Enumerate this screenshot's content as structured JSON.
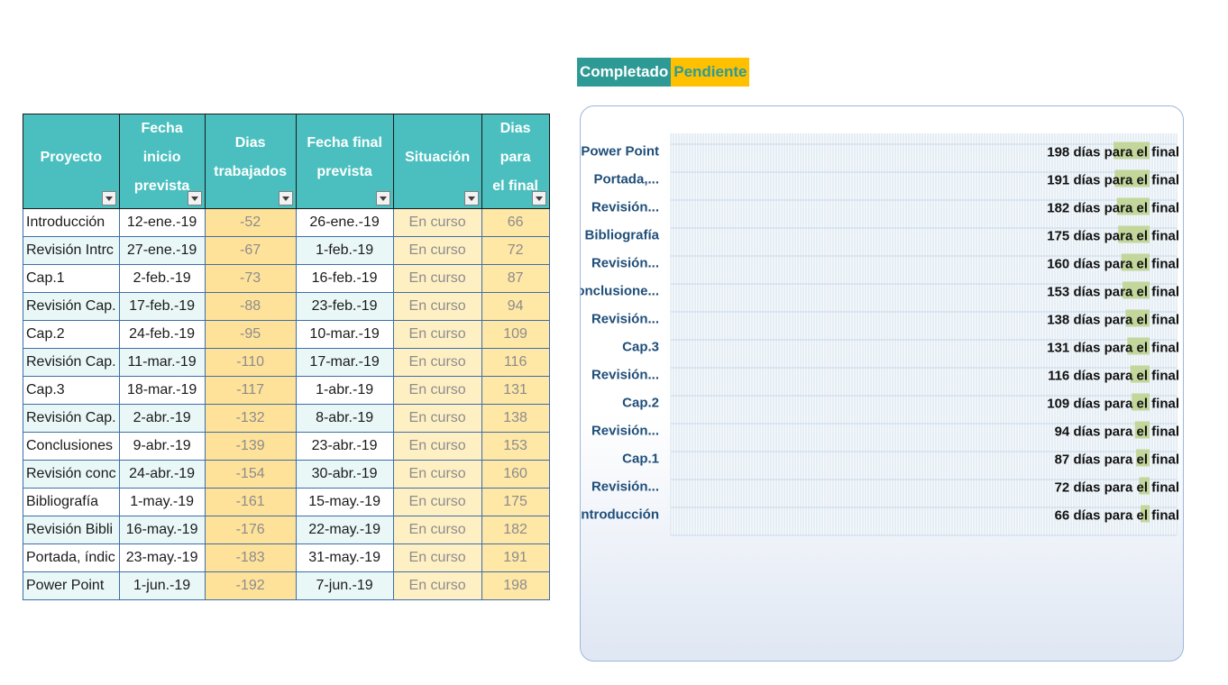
{
  "table": {
    "headers": {
      "project": "Proyecto",
      "start": [
        "Fecha inicio",
        "prevista"
      ],
      "worked": [
        "Dias",
        "trabajados"
      ],
      "end": [
        "Fecha final",
        "prevista"
      ],
      "status": "Situación",
      "remaining": [
        "Dias para",
        "el final"
      ]
    },
    "rows": [
      {
        "project": "Introducción",
        "start": "12-ene.-19",
        "worked": "-52",
        "end": "26-ene.-19",
        "status": "En curso",
        "remaining": "66"
      },
      {
        "project": "Revisión Intrc",
        "start": "27-ene.-19",
        "worked": "-67",
        "end": "1-feb.-19",
        "status": "En curso",
        "remaining": "72"
      },
      {
        "project": "Cap.1",
        "start": "2-feb.-19",
        "worked": "-73",
        "end": "16-feb.-19",
        "status": "En curso",
        "remaining": "87"
      },
      {
        "project": "Revisión Cap.",
        "start": "17-feb.-19",
        "worked": "-88",
        "end": "23-feb.-19",
        "status": "En curso",
        "remaining": "94"
      },
      {
        "project": "Cap.2",
        "start": "24-feb.-19",
        "worked": "-95",
        "end": "10-mar.-19",
        "status": "En curso",
        "remaining": "109"
      },
      {
        "project": "Revisión Cap.",
        "start": "11-mar.-19",
        "worked": "-110",
        "end": "17-mar.-19",
        "status": "En curso",
        "remaining": "116"
      },
      {
        "project": "Cap.3",
        "start": "18-mar.-19",
        "worked": "-117",
        "end": "1-abr.-19",
        "status": "En curso",
        "remaining": "131"
      },
      {
        "project": "Revisión Cap.",
        "start": "2-abr.-19",
        "worked": "-132",
        "end": "8-abr.-19",
        "status": "En curso",
        "remaining": "138"
      },
      {
        "project": "Conclusiones",
        "start": "9-abr.-19",
        "worked": "-139",
        "end": "23-abr.-19",
        "status": "En curso",
        "remaining": "153"
      },
      {
        "project": "Revisión conc",
        "start": "24-abr.-19",
        "worked": "-154",
        "end": "30-abr.-19",
        "status": "En curso",
        "remaining": "160"
      },
      {
        "project": "Bibliografía",
        "start": "1-may.-19",
        "worked": "-161",
        "end": "15-may.-19",
        "status": "En curso",
        "remaining": "175"
      },
      {
        "project": "Revisión Bibli",
        "start": "16-may.-19",
        "worked": "-176",
        "end": "22-may.-19",
        "status": "En curso",
        "remaining": "182"
      },
      {
        "project": "Portada, índic",
        "start": "23-may.-19",
        "worked": "-183",
        "end": "31-may.-19",
        "status": "En curso",
        "remaining": "191"
      },
      {
        "project": "Power Point",
        "start": "1-jun.-19",
        "worked": "-192",
        "end": "7-jun.-19",
        "status": "En curso",
        "remaining": "198"
      }
    ]
  },
  "legend": {
    "completed": "Completado",
    "pending": "Pendiente"
  },
  "colors": {
    "header_teal": "#4bbfbf",
    "completed": "#2e9a95",
    "pending": "#ffc000",
    "chart_bar": "#c3d69b",
    "category_text": "#1f4e79"
  },
  "chart_data": {
    "type": "bar",
    "orientation": "horizontal",
    "categories": [
      "Power Point",
      "Portada,...",
      "Revisión...",
      "Bibliografía",
      "Revisión...",
      "Conclusione...",
      "Revisión...",
      "Cap.3",
      "Revisión...",
      "Cap.2",
      "Revisión...",
      "Cap.1",
      "Revisión...",
      "Introducción"
    ],
    "series": [
      {
        "values": [
          198,
          191,
          182,
          175,
          160,
          153,
          138,
          131,
          116,
          109,
          94,
          87,
          72,
          66
        ]
      }
    ],
    "data_labels": [
      "198 días para el final",
      "191 días para el final",
      "182 días para el final",
      "175 días para el final",
      "160 días para el final",
      "153 días para el final",
      "138 días para el final",
      "131 días para el final",
      "116 días para el final",
      "109 días para el final",
      "94 días para el final",
      "87 días para el final",
      "72 días para el final",
      "66 días para el final"
    ],
    "grid": true,
    "legend_position": "top-left"
  }
}
